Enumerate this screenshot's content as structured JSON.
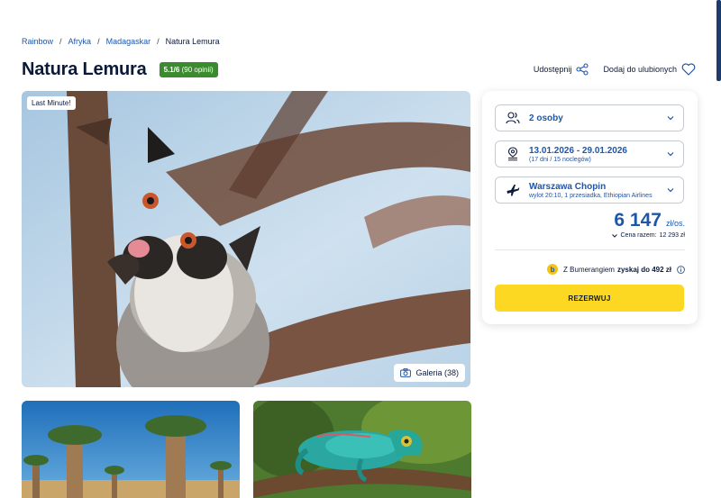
{
  "breadcrumb": {
    "items": [
      "Rainbow",
      "Afryka",
      "Madagaskar"
    ],
    "current": "Natura Lemura"
  },
  "header": {
    "title": "Natura Lemura",
    "rating_score": "5.1/6",
    "rating_reviews": "(90 opinii)",
    "share_label": "Udostępnij",
    "favorite_label": "Dodaj do ulubionych"
  },
  "hero": {
    "badge": "Last Minute!",
    "gallery_label": "Galeria (38)"
  },
  "booking": {
    "persons": "2 osoby",
    "dates": "13.01.2026 - 29.01.2026",
    "dates_sub": "(17 dni / 15 noclegów)",
    "departure": "Warszawa Chopin",
    "departure_sub": "wylot 20:10, 1 przesiadka, Ethiopian Airlines",
    "price": "6 147",
    "price_unit": "zł/os.",
    "total_label": "Cena razem:",
    "total_value": "12 293 zł",
    "bumerang_logo": "b",
    "bumerang_text": "Z Bumerangiem",
    "bumerang_bold": "zyskaj do 492 zł",
    "reserve_label": "REZERWUJ"
  },
  "colors": {
    "brand_blue": "#1e56a8",
    "navy": "#0b1a3a",
    "rating_green": "#3a8a2e",
    "cta_yellow": "#fcd822"
  }
}
